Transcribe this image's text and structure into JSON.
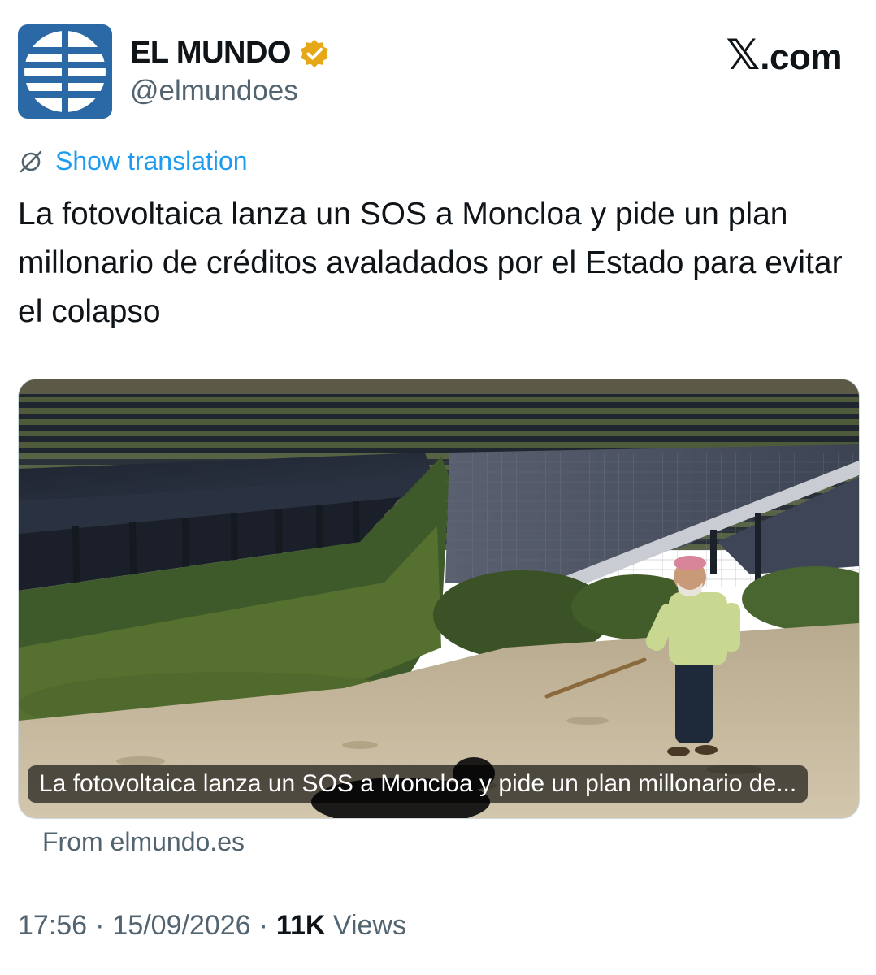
{
  "account": {
    "name": "EL MUNDO",
    "handle": "@elmundoes",
    "avatar_icon": "globe-icon",
    "verified_icon": "verified-badge-icon",
    "avatar_color": "#2b69a6",
    "verified_color": "#e6a817"
  },
  "brand": {
    "x_glyph": "𝕏",
    "suffix": ".com"
  },
  "translation": {
    "icon": "globe-slash-icon",
    "label": "Show translation",
    "color": "#1d9bf0"
  },
  "tweet": {
    "text": "La fotovoltaica lanza un SOS a Moncloa y pide un plan millonario de créditos avaladados por el Estado para evitar el colapso"
  },
  "card": {
    "caption": "La fotovoltaica lanza un SOS a Moncloa y pide un plan millonario de...",
    "source": "From elmundo.es"
  },
  "meta": {
    "time": "17:56",
    "separator": "·",
    "date": "15/09/2026",
    "views_count": "11K",
    "views_label": "Views"
  }
}
